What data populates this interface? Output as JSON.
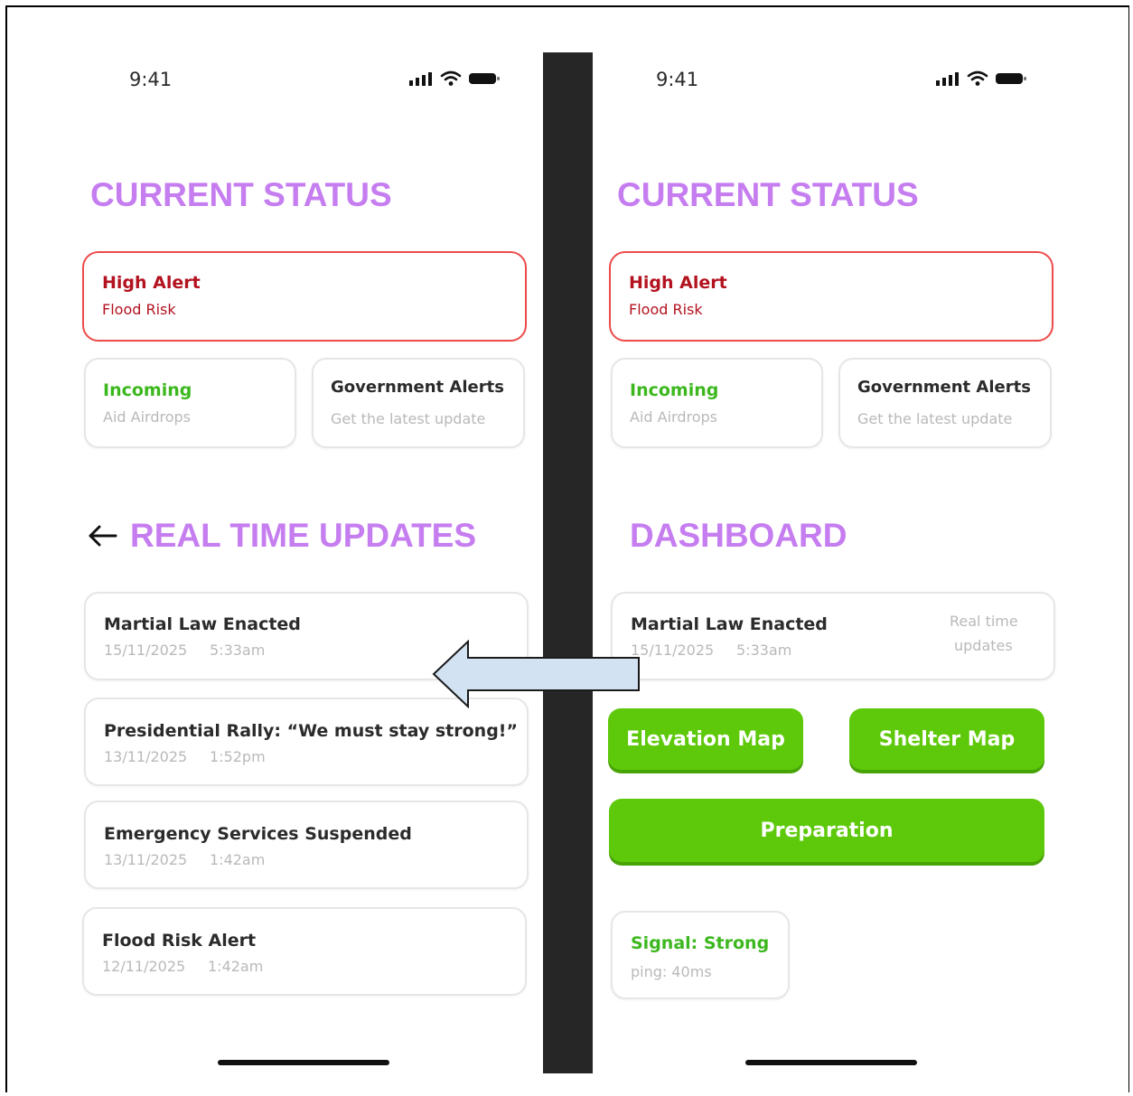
{
  "left_screen": {
    "status_bar": {
      "time": "9:41"
    },
    "current_status": {
      "heading": "CURRENT STATUS",
      "alert": {
        "title": "High Alert",
        "subtitle": "Flood Risk"
      },
      "incoming": {
        "title": "Incoming",
        "subtitle": "Aid Airdrops"
      },
      "gov_alerts": {
        "title": "Government Alerts",
        "subtitle": "Get the latest update"
      }
    },
    "updates": {
      "heading": "REAL TIME UPDATES",
      "items": [
        {
          "title": "Martial Law Enacted",
          "date": "15/11/2025",
          "time": "5:33am"
        },
        {
          "title": "Presidential Rally: “We must stay strong!”",
          "date": "13/11/2025",
          "time": "1:52pm"
        },
        {
          "title": "Emergency Services Suspended",
          "date": "13/11/2025",
          "time": "1:42am"
        },
        {
          "title": "Flood Risk Alert",
          "date": "12/11/2025",
          "time": "1:42am"
        }
      ]
    }
  },
  "right_screen": {
    "status_bar": {
      "time": "9:41"
    },
    "current_status": {
      "heading": "CURRENT STATUS",
      "alert": {
        "title": "High Alert",
        "subtitle": "Flood Risk"
      },
      "incoming": {
        "title": "Incoming",
        "subtitle": "Aid Airdrops"
      },
      "gov_alerts": {
        "title": "Government Alerts",
        "subtitle": "Get the latest update"
      }
    },
    "dashboard": {
      "heading": "DASHBOARD",
      "latest": {
        "title": "Martial Law Enacted",
        "date": "15/11/2025",
        "time": "5:33am",
        "link_line1": "Real time",
        "link_line2": "updates"
      },
      "elevation_map": "Elevation Map",
      "shelter_map": "Shelter Map",
      "preparation": "Preparation",
      "signal": {
        "title": "Signal: Strong",
        "subtitle": "ping: 40ms"
      }
    }
  },
  "colors": {
    "heading": "#c57df0",
    "alert_border": "#ee4b4b",
    "alert_text": "#b3121f",
    "incoming_green": "#3cb81e",
    "button_green": "#5ec90a",
    "divider": "#262626",
    "arrow_fill": "#d3e2f2"
  },
  "icons": [
    "signal-bars-icon",
    "wifi-icon",
    "battery-icon",
    "back-arrow-icon",
    "transition-arrow-icon"
  ]
}
